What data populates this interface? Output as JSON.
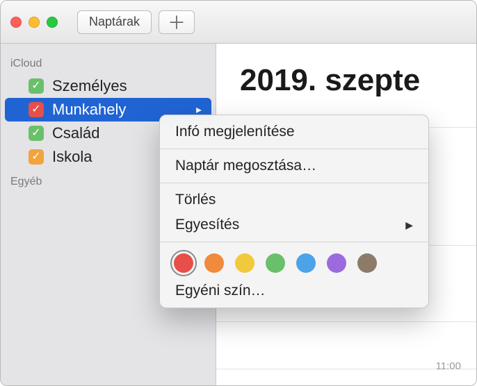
{
  "toolbar": {
    "calendars_label": "Naptárak"
  },
  "sidebar": {
    "group1_label": "iCloud",
    "group2_label": "Egyéb",
    "items": [
      {
        "label": "Személyes",
        "color": "#6ac06a"
      },
      {
        "label": "Munkahely",
        "color": "#e74f4a"
      },
      {
        "label": "Család",
        "color": "#6ac06a"
      },
      {
        "label": "Iskola",
        "color": "#f2a33c"
      }
    ]
  },
  "main": {
    "date_title": "2019. szepte",
    "time_11": "11:00"
  },
  "ctx": {
    "show_info": "Infó megjelenítése",
    "share": "Naptár megosztása…",
    "delete": "Törlés",
    "merge": "Egyesítés",
    "custom_color": "Egyéni szín…",
    "colors": [
      "#e74f4a",
      "#f08a3c",
      "#f2c93c",
      "#6ac06a",
      "#4da3e8",
      "#9b6adf",
      "#8d7b6a"
    ]
  }
}
